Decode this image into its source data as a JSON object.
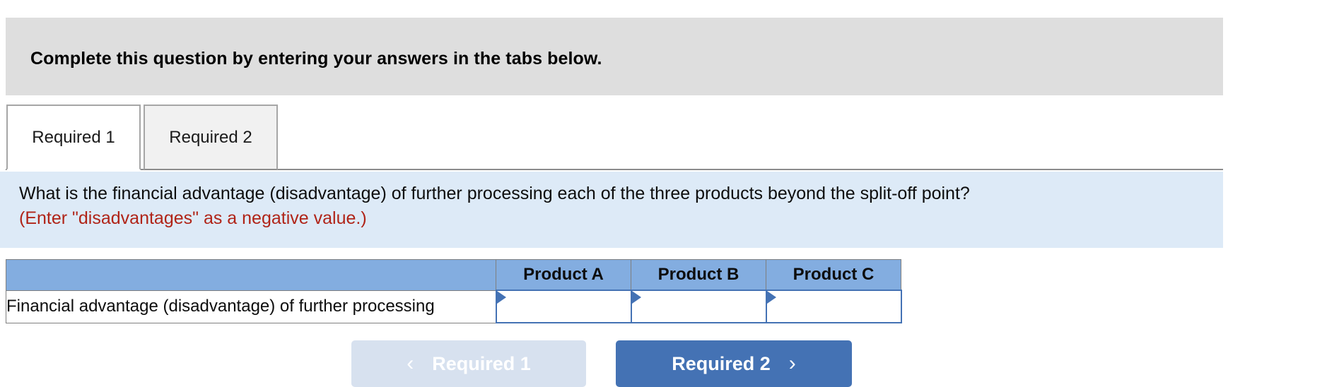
{
  "instruction": {
    "text": "Complete this question by entering your answers in the tabs below."
  },
  "tabs": [
    {
      "label": "Required 1",
      "active": true
    },
    {
      "label": "Required 2",
      "active": false
    }
  ],
  "question": {
    "prompt": "What is the financial advantage (disadvantage) of further processing each of the three products beyond the split-off point?",
    "note": "(Enter \"disadvantages\" as a negative value.)",
    "note_color": "#b02418"
  },
  "table": {
    "header_blank": "",
    "columns": [
      "Product A",
      "Product B",
      "Product C"
    ],
    "header_bg": "#83ade0",
    "rows": [
      {
        "label": "Financial advantage (disadvantage) of further processing",
        "values": [
          "",
          "",
          ""
        ],
        "placeholders": [
          "",
          "",
          ""
        ]
      }
    ]
  },
  "navigation": {
    "prev": {
      "label": "Required 1",
      "icon": "chevron-left-icon",
      "glyph": "‹",
      "disabled": true,
      "bg": "#d7e1ef"
    },
    "next": {
      "label": "Required 2",
      "icon": "chevron-right-icon",
      "glyph": "›",
      "disabled": false,
      "bg": "#4472b4"
    }
  }
}
